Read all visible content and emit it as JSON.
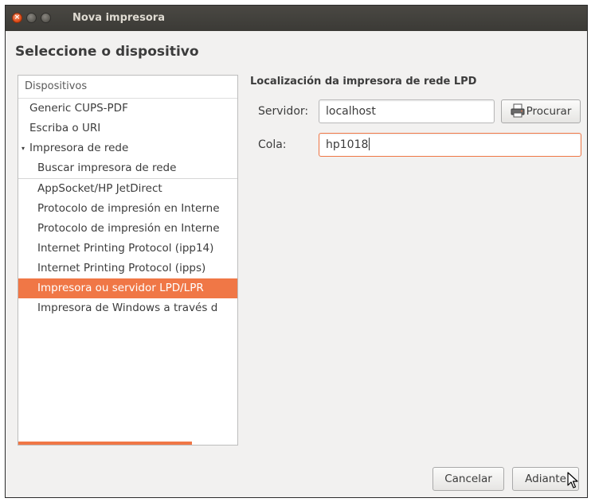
{
  "window": {
    "title": "Nova impresora",
    "heading": "Seleccione o dispositivo"
  },
  "devices": {
    "header": "Dispositivos",
    "items": [
      {
        "label": "Generic CUPS-PDF"
      },
      {
        "label": "Escriba o URI"
      },
      {
        "label": "Impresora de rede",
        "expander": "▾"
      },
      {
        "label": "Buscar impresora de rede"
      },
      {
        "label": "AppSocket/HP JetDirect"
      },
      {
        "label": "Protocolo de impresión en Interne"
      },
      {
        "label": "Protocolo de impresión en Interne"
      },
      {
        "label": "Internet Printing Protocol (ipp14)"
      },
      {
        "label": "Internet Printing Protocol (ipps)"
      },
      {
        "label": "Impresora ou servidor LPD/LPR",
        "selected": true
      },
      {
        "label": "Impresora de Windows a través d"
      }
    ]
  },
  "form": {
    "section_title": "Localización da impresora de rede LPD",
    "server_label": "Servidor:",
    "server_value": "localhost",
    "browse_label": "Procurar",
    "queue_label": "Cola:",
    "queue_value": "hp1018"
  },
  "buttons": {
    "cancel": "Cancelar",
    "forward": "Adiante"
  },
  "colors": {
    "accent": "#f07746",
    "titlebar": "#3c3b37"
  },
  "icons": {
    "close": "close-icon",
    "minimize": "minimize-icon",
    "maximize": "maximize-icon",
    "expander": "triangle-down-icon",
    "browse": "printer-icon",
    "cursor": "mouse-pointer-icon"
  }
}
